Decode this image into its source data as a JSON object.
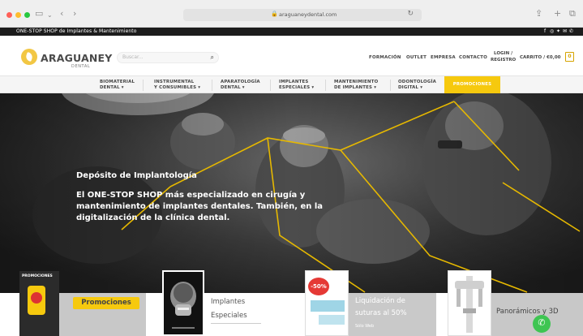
{
  "browser": {
    "url": "araguaneydental.com",
    "icons": [
      "sidebar-icon",
      "back-icon",
      "forward-icon",
      "lock-icon",
      "reload-icon",
      "share-icon",
      "new-tab-icon",
      "tabs-icon"
    ]
  },
  "topbar": {
    "text": "ONE-STOP SHOP de Implantes & Mantenimiento",
    "social_icons": [
      "facebook-icon",
      "instagram-icon",
      "twitter-icon",
      "email-icon",
      "phone-icon"
    ]
  },
  "header": {
    "logo_text": "ARAGUANEY",
    "logo_sub": "DENTAL",
    "search_placeholder": "Buscar...",
    "nav": [
      "FORMACIÓN",
      "OUTLET",
      "EMPRESA",
      "CONTACTO"
    ],
    "login_line1": "LOGIN /",
    "login_line2": "REGISTRO",
    "cart_label": "CARRITO / €0,00",
    "cart_count": "0"
  },
  "categories": [
    {
      "line1": "BIOMATERIAL",
      "line2": "DENTAL ▾"
    },
    {
      "line1": "INSTRUMENTAL",
      "line2": "Y CONSUMIBLES ▾"
    },
    {
      "line1": "APARATOLOGÍA",
      "line2": "DENTAL ▾"
    },
    {
      "line1": "IMPLANTES",
      "line2": "ESPECIALES ▾"
    },
    {
      "line1": "MANTENIMIENTO",
      "line2": "DE IMPLANTES ▾"
    },
    {
      "line1": "ODONTOLOGÍA",
      "line2": "DIGITAL ▾"
    },
    {
      "line1": "PROMOCIONES",
      "line2": ""
    }
  ],
  "hero": {
    "title": "Depósito de Implantología",
    "subtitle": "El ONE-STOP SHOP más especializado en cirugía y mantenimiento de implantes dentales. También, en la digitalización de la clínica dental."
  },
  "tiles": [
    {
      "label": "Promociones",
      "thumb_text": "PROMOCIONES"
    },
    {
      "label_line1": "Implantes",
      "label_line2": "Especiales"
    },
    {
      "label_line1": "Liquidación de",
      "label_line2": "suturas al 50%",
      "badge": "-50%",
      "small": "Sólo Web"
    },
    {
      "label": "Panorámicos y 3D"
    }
  ],
  "colors": {
    "brand_yellow": "#f6c90e",
    "dark": "#1c1c1c",
    "whatsapp": "#3ec552"
  }
}
